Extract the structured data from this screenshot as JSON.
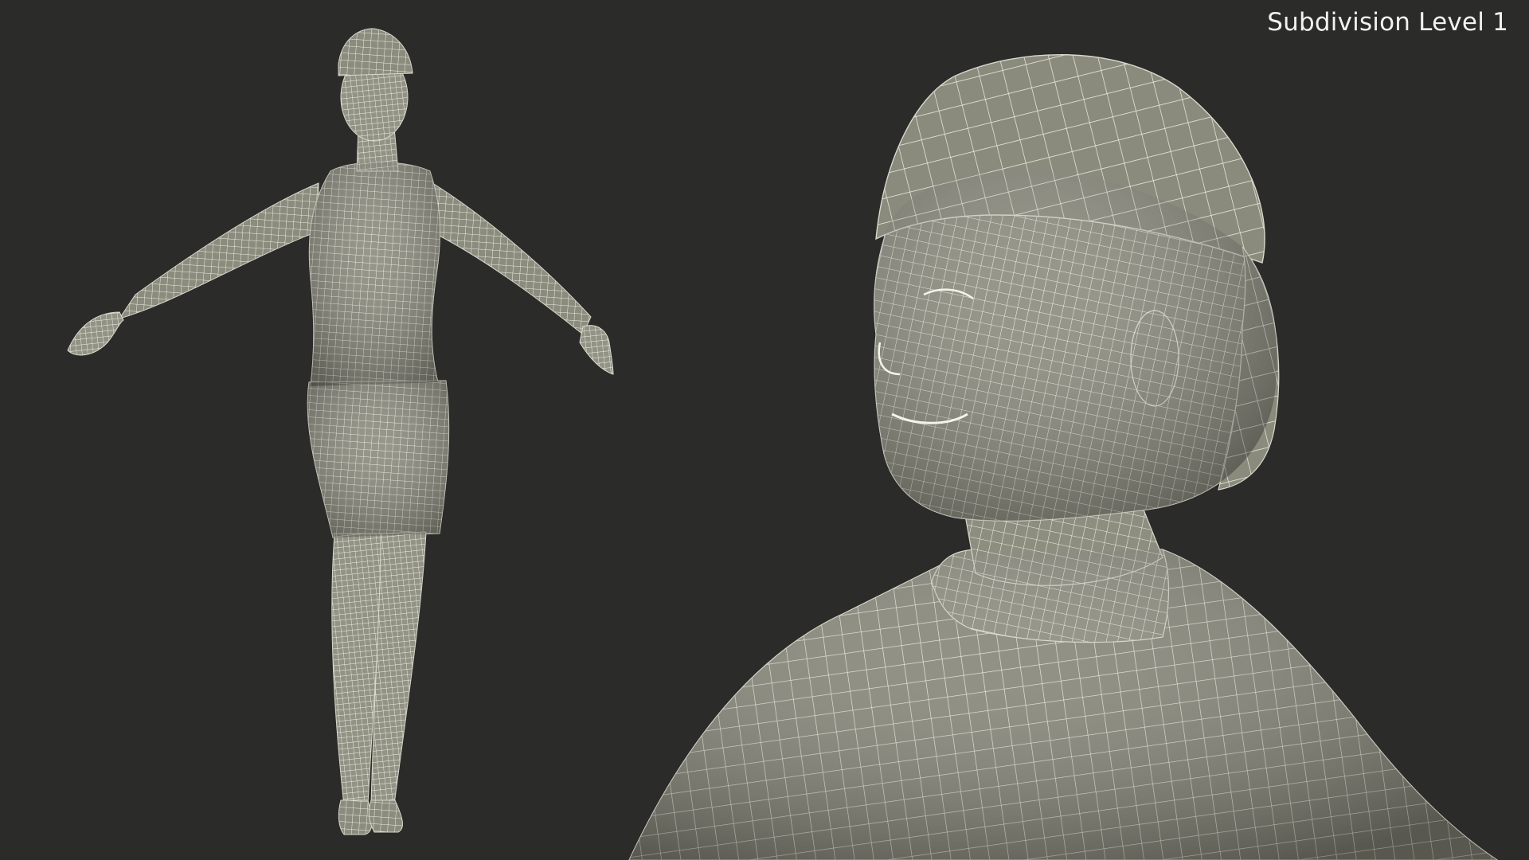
{
  "viewport": {
    "label": "Subdivision Level 1"
  },
  "colors": {
    "background": "#2b2b2a",
    "mesh_fill": "#8a8a7c",
    "wire": "#f1f1e6"
  },
  "scene": {
    "left_view": "full-body-wireframe",
    "right_view": "head-closeup-wireframe"
  }
}
